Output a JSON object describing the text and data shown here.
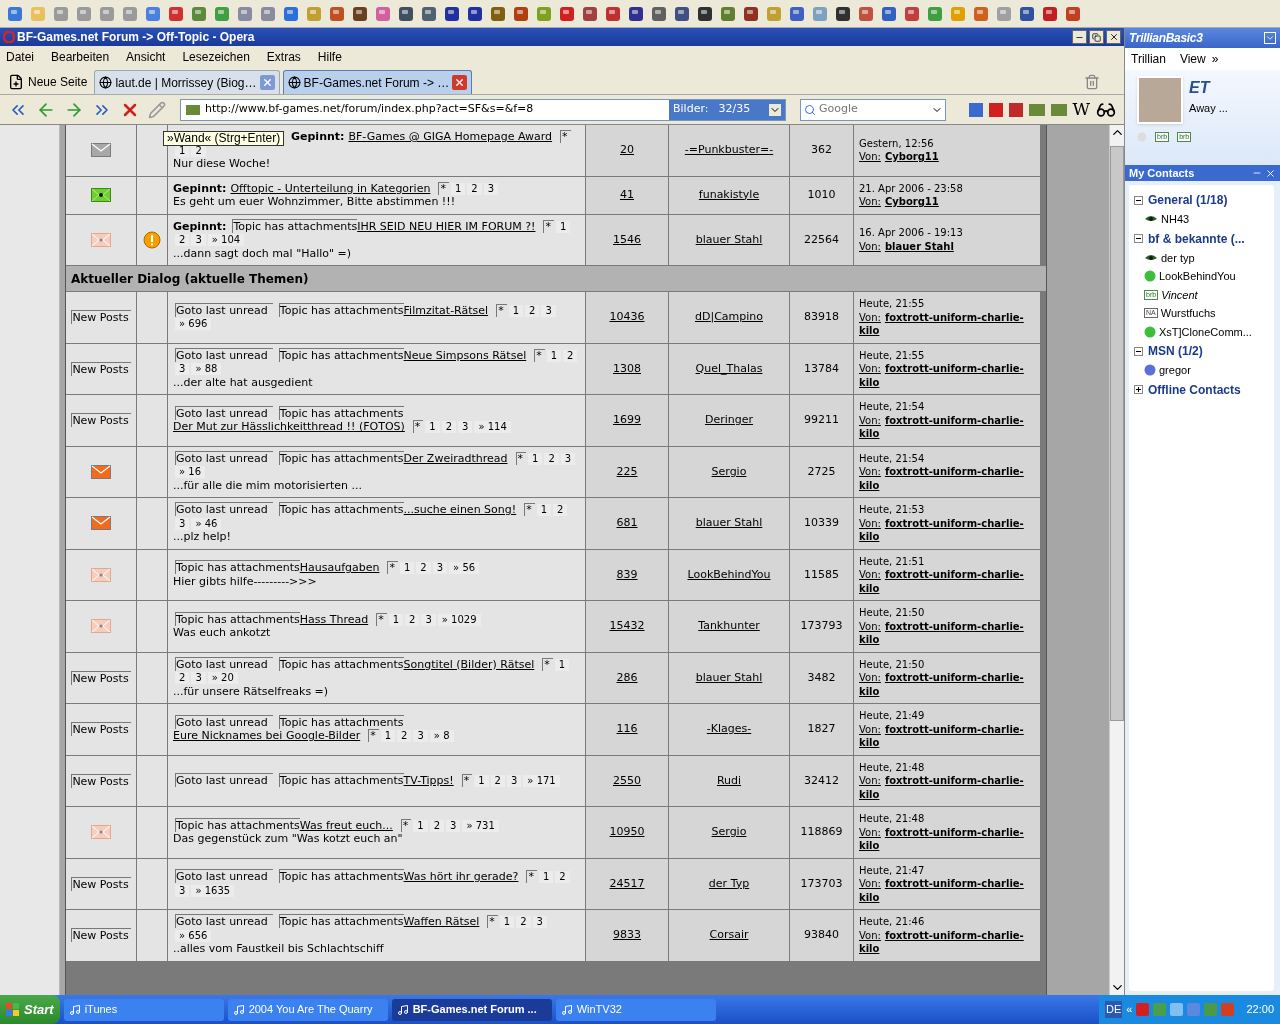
{
  "browser": {
    "title": "BF-Games.net Forum -> Off-Topic - Opera",
    "menu": [
      "Datei",
      "Bearbeiten",
      "Ansicht",
      "Lesezeichen",
      "Extras",
      "Hilfe"
    ],
    "new_tab": "Neue Seite",
    "tabs": [
      {
        "label": "laut.de | Morrissey (Biog…",
        "selected": false
      },
      {
        "label": "BF-Games.net Forum -> …",
        "selected": true
      }
    ],
    "url": "http://www.bf-games.net/forum/index.php?act=SF&s=&f=8",
    "images_label": "Bilder:",
    "images_count": "32/35",
    "search_placeholder": "Google",
    "wiki_button": "W"
  },
  "forum": {
    "tooltip": "»Wand« (Strg+Enter)",
    "section_title": "Aktueller Dialog (aktuelle Themen)",
    "pinned": [
      {
        "icon": {
          "kind": "mail_grey"
        },
        "warning": false,
        "prefix": "Gepinnt:",
        "title": "BF-Games @ GIGA Homepage Award",
        "marker": "*",
        "pages": [
          "1",
          "2"
        ],
        "desc": "Nur diese Woche!",
        "replies": "20",
        "starter": "-=Punkbuster=-",
        "views": "362",
        "last_date": "Gestern, 12:56",
        "last_label": "Von:",
        "last_by": "Cyborg11"
      },
      {
        "icon": {
          "kind": "poll"
        },
        "warning": false,
        "prefix": "Gepinnt:",
        "title": "Offtopic - Unterteilung in Kategorien",
        "marker": "*",
        "pages": [
          "1",
          "2",
          "3"
        ],
        "desc": "Es geht um euer Wohnzimmer, Bitte abstimmen !!!",
        "replies": "41",
        "starter": "funakistyle",
        "views": "1010",
        "last_date": "21. Apr 2006 - 23:58",
        "last_label": "Von:",
        "last_by": "Cyborg11"
      },
      {
        "icon": {
          "kind": "hot_pink"
        },
        "warning": true,
        "prefix": "Gepinnt:",
        "badges": [
          "Topic has attachments"
        ],
        "title": "IHR SEID NEU HIER IM FORUM ?!",
        "marker": "*",
        "pages": [
          "1",
          "2",
          "3",
          "» 104"
        ],
        "desc": "...dann sagt doch mal \"Hallo\" =)",
        "replies": "1546",
        "starter": "blauer Stahl",
        "views": "22564",
        "last_date": "16. Apr 2006 - 19:13",
        "last_label": "Von:",
        "last_by": "blauer Stahl"
      }
    ],
    "topics": [
      {
        "icon": {
          "kind": "new_posts",
          "label": "New Posts"
        },
        "warning": false,
        "badges": [
          "Goto last unread",
          "Topic has attachments"
        ],
        "title": "Filmzitat-Rätsel",
        "marker": "*",
        "pages": [
          "1",
          "2",
          "3",
          "» 696"
        ],
        "replies": "10436",
        "starter": "dD|Campino",
        "views": "83918",
        "last_date": "Heute, 21:55",
        "last_label": "Von:",
        "last_by": "foxtrott-uniform-charlie-kilo"
      },
      {
        "icon": {
          "kind": "new_posts",
          "label": "New Posts"
        },
        "warning": false,
        "badges": [
          "Goto last unread",
          "Topic has attachments"
        ],
        "title": "Neue Simpsons Rätsel",
        "marker": "*",
        "pages": [
          "1",
          "2",
          "3",
          "» 88"
        ],
        "desc": "...der alte hat ausgedient",
        "replies": "1308",
        "starter": "Quel_Thalas",
        "views": "13784",
        "last_date": "Heute, 21:55",
        "last_label": "Von:",
        "last_by": "foxtrott-uniform-charlie-kilo"
      },
      {
        "icon": {
          "kind": "new_posts",
          "label": "New Posts"
        },
        "warning": false,
        "badges": [
          "Goto last unread",
          "Topic has attachments"
        ],
        "title": "Der Mut zur Hässlichkeitthread !! (FOTOS)",
        "marker": "*",
        "pages": [
          "1",
          "2",
          "3",
          "» 114"
        ],
        "replies": "1699",
        "starter": "Deringer",
        "views": "99211",
        "last_date": "Heute, 21:54",
        "last_label": "Von:",
        "last_by": "foxtrott-uniform-charlie-kilo"
      },
      {
        "icon": {
          "kind": "mail_orange"
        },
        "warning": false,
        "badges": [
          "Goto last unread",
          "Topic has attachments"
        ],
        "title": "Der Zweiradthread",
        "marker": "*",
        "pages": [
          "1",
          "2",
          "3",
          "» 16"
        ],
        "desc": "...für alle die mim motorisierten ...",
        "replies": "225",
        "starter": "Sergio",
        "views": "2725",
        "last_date": "Heute, 21:54",
        "last_label": "Von:",
        "last_by": "foxtrott-uniform-charlie-kilo"
      },
      {
        "icon": {
          "kind": "mail_orange"
        },
        "warning": false,
        "badges": [
          "Goto last unread",
          "Topic has attachments"
        ],
        "title": "...suche einen Song!",
        "marker": "*",
        "pages": [
          "1",
          "2",
          "3",
          "» 46"
        ],
        "desc": "...plz help!",
        "replies": "681",
        "starter": "blauer Stahl",
        "views": "10339",
        "last_date": "Heute, 21:53",
        "last_label": "Von:",
        "last_by": "foxtrott-uniform-charlie-kilo"
      },
      {
        "icon": {
          "kind": "hot_pink"
        },
        "warning": false,
        "badges": [
          "Topic has attachments"
        ],
        "title": "Hausaufgaben",
        "marker": "*",
        "pages": [
          "1",
          "2",
          "3",
          "» 56"
        ],
        "desc": "Hier gibts hilfe--------->>>",
        "replies": "839",
        "starter": "LookBehindYou",
        "views": "11585",
        "last_date": "Heute, 21:51",
        "last_label": "Von:",
        "last_by": "foxtrott-uniform-charlie-kilo"
      },
      {
        "icon": {
          "kind": "hot_pink"
        },
        "warning": false,
        "badges": [
          "Topic has attachments"
        ],
        "title": "Hass Thread",
        "marker": "*",
        "pages": [
          "1",
          "2",
          "3",
          "» 1029"
        ],
        "desc": "Was euch ankotzt",
        "replies": "15432",
        "starter": "Tankhunter",
        "views": "173793",
        "last_date": "Heute, 21:50",
        "last_label": "Von:",
        "last_by": "foxtrott-uniform-charlie-kilo"
      },
      {
        "icon": {
          "kind": "new_posts",
          "label": "New Posts"
        },
        "warning": false,
        "badges": [
          "Goto last unread",
          "Topic has attachments"
        ],
        "title": "Songtitel (Bilder) Rätsel",
        "marker": "*",
        "pages": [
          "1",
          "2",
          "3",
          "» 20"
        ],
        "desc": "...für unsere Rätselfreaks =)",
        "replies": "286",
        "starter": "blauer Stahl",
        "views": "3482",
        "last_date": "Heute, 21:50",
        "last_label": "Von:",
        "last_by": "foxtrott-uniform-charlie-kilo"
      },
      {
        "icon": {
          "kind": "new_posts",
          "label": "New Posts"
        },
        "warning": false,
        "badges": [
          "Goto last unread",
          "Topic has attachments"
        ],
        "title": "Eure Nicknames bei Google-Bilder",
        "marker": "*",
        "pages": [
          "1",
          "2",
          "3",
          "» 8"
        ],
        "replies": "116",
        "starter": "-Klages-",
        "views": "1827",
        "last_date": "Heute, 21:49",
        "last_label": "Von:",
        "last_by": "foxtrott-uniform-charlie-kilo"
      },
      {
        "icon": {
          "kind": "new_posts",
          "label": "New Posts"
        },
        "warning": false,
        "badges": [
          "Goto last unread",
          "Topic has attachments"
        ],
        "title": "TV-Tipps!",
        "marker": "*",
        "pages": [
          "1",
          "2",
          "3",
          "» 171"
        ],
        "replies": "2550",
        "starter": "Rudi",
        "views": "32412",
        "last_date": "Heute, 21:48",
        "last_label": "Von:",
        "last_by": "foxtrott-uniform-charlie-kilo"
      },
      {
        "icon": {
          "kind": "hot_pink"
        },
        "warning": false,
        "badges": [
          "Topic has attachments"
        ],
        "title": "Was freut euch...",
        "marker": "*",
        "pages": [
          "1",
          "2",
          "3",
          "» 731"
        ],
        "desc": "Das gegenstück zum \"Was kotzt euch an\"",
        "replies": "10950",
        "starter": "Sergio",
        "views": "118869",
        "last_date": "Heute, 21:48",
        "last_label": "Von:",
        "last_by": "foxtrott-uniform-charlie-kilo"
      },
      {
        "icon": {
          "kind": "new_posts",
          "label": "New Posts"
        },
        "warning": false,
        "badges": [
          "Goto last unread",
          "Topic has attachments"
        ],
        "title": "Was hört ihr gerade?",
        "marker": "*",
        "pages": [
          "1",
          "2",
          "3",
          "» 1635"
        ],
        "replies": "24517",
        "starter": "der Typ",
        "views": "173703",
        "last_date": "Heute, 21:47",
        "last_label": "Von:",
        "last_by": "foxtrott-uniform-charlie-kilo"
      },
      {
        "icon": {
          "kind": "new_posts",
          "label": "New Posts"
        },
        "warning": false,
        "badges": [
          "Goto last unread",
          "Topic has attachments"
        ],
        "title": "Waffen Rätsel",
        "marker": "*",
        "pages": [
          "1",
          "2",
          "3",
          "» 656"
        ],
        "desc": "..alles vom Faustkeil bis Schlachtschiff",
        "replies": "9833",
        "starter": "Corsair",
        "views": "93840",
        "last_date": "Heute, 21:46",
        "last_label": "Von:",
        "last_by": "foxtrott-uniform-charlie-kilo"
      }
    ]
  },
  "trillian": {
    "logo": "TrillianBasic3",
    "menu": [
      "Trillian",
      "View"
    ],
    "more": "»",
    "user": {
      "name": "ET",
      "status": "Away ..."
    },
    "status_icons": [
      {
        "kind": "off"
      },
      {
        "kind": "brb",
        "label": "brb"
      },
      {
        "kind": "brb",
        "label": "brb"
      }
    ],
    "contacts_title": "My Contacts",
    "groups": [
      {
        "name": "General (1/18)",
        "expanded": true,
        "children": [
          {
            "name": "NH43",
            "kind": "eye"
          }
        ]
      },
      {
        "name": "bf & bekannte (...",
        "expanded": true,
        "children": [
          {
            "name": "der typ",
            "kind": "eye"
          },
          {
            "name": "LookBehindYou",
            "kind": "online"
          },
          {
            "name": "Vincent",
            "kind": "away",
            "badge": "brb"
          },
          {
            "name": "Wurstfuchs",
            "kind": "na",
            "badge": "NA"
          },
          {
            "name": "XsT]CloneComm...",
            "kind": "online"
          }
        ]
      },
      {
        "name": "MSN (1/2)",
        "expanded": true,
        "children": [
          {
            "name": "gregor",
            "kind": "msn"
          }
        ]
      },
      {
        "name": "Offline Contacts",
        "expanded": false
      }
    ]
  },
  "taskbar": {
    "start": "Start",
    "tasks": [
      {
        "label": "iTunes",
        "selected": false
      },
      {
        "label": "2004 You Are The Quarry",
        "selected": false
      },
      {
        "label": "BF-Games.net Forum ...",
        "selected": true
      },
      {
        "label": "WinTV32",
        "selected": false
      }
    ],
    "language": "DE",
    "tray_more": "«",
    "clock": "22:00"
  }
}
